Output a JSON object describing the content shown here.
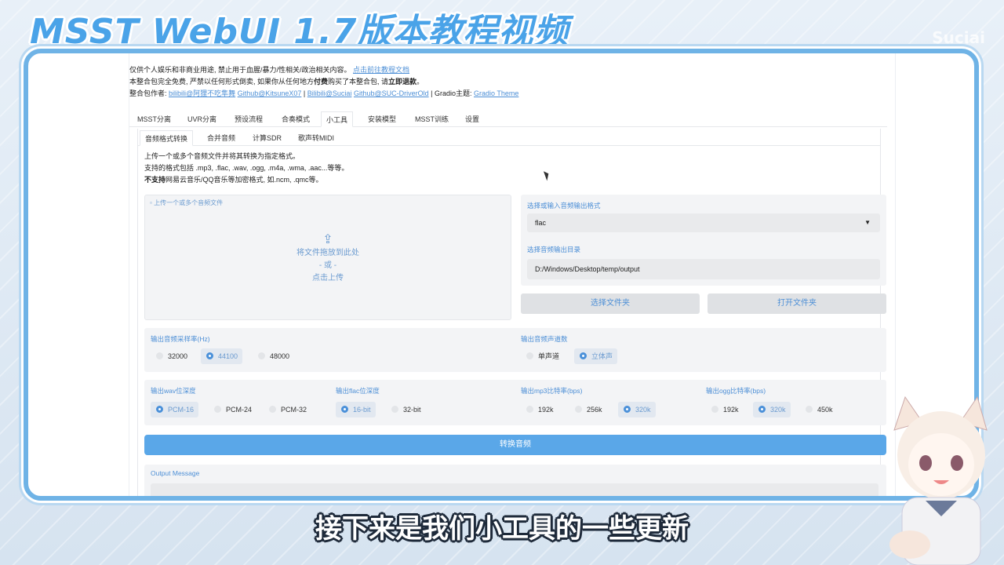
{
  "video": {
    "title": "MSST WebUI 1.7版本教程视频",
    "watermark": "Suciai",
    "subtitle": "接下来是我们小工具的一些更新"
  },
  "intro": {
    "line1_text": "仅供个人娱乐和非商业用途, 禁止用于血腥/暴力/性相关/政治相关内容。",
    "line1_link": "点击前往教程文档",
    "line2_pre": "本整合包完全免费, 严禁以任何形式倒卖, 如果你从任何地方",
    "line2_bold1": "付费",
    "line2_mid": "购买了本整合包, 请",
    "line2_bold2": "立即退款",
    "line2_end": "。",
    "line3_label": "整合包作者:",
    "author_links": [
      "bilibili@阿狸不吃隼舞",
      "Github@KitsuneX07",
      "Bilibili@Suciai",
      "Github@SUC-DriverOld"
    ],
    "sep": "|",
    "gradio_label": "| Gradio主题:",
    "gradio_link": "Gradio Theme"
  },
  "tabs": [
    "MSST分离",
    "UVR分离",
    "预设流程",
    "合奏模式",
    "小工具",
    "安装模型",
    "MSST训练",
    "设置"
  ],
  "subtabs": [
    "音频格式转换",
    "合并音频",
    "计算SDR",
    "歌声转MIDI"
  ],
  "desc": {
    "line1": "上传一个或多个音频文件并将其转换为指定格式。",
    "line2": "支持的格式包括 .mp3, .flac, .wav, .ogg, .m4a, .wma, .aac...等等。",
    "line3_bold": "不支持",
    "line3_rest": "网易云音乐/QQ音乐等加密格式, 如.ncm, .qmc等。"
  },
  "upload": {
    "label": "上传一个或多个音频文件",
    "drop_text": "将文件拖放到此处",
    "or_text": "- 或 -",
    "click_text": "点击上传"
  },
  "format": {
    "label": "选择或输入音频输出格式",
    "value": "flac",
    "dir_label": "选择音频输出目录",
    "dir_value": "D:/Windows/Desktop/temp/output"
  },
  "buttons": {
    "select_folder": "选择文件夹",
    "open_folder": "打开文件夹",
    "convert": "转换音频"
  },
  "sample_rate": {
    "label": "输出音频采样率(Hz)",
    "options": [
      "32000",
      "44100",
      "48000"
    ],
    "selected": "44100"
  },
  "channels": {
    "label": "输出音频声道数",
    "options": [
      "单声道",
      "立体声"
    ],
    "selected": "立体声"
  },
  "wav_depth": {
    "label": "输出wav位深度",
    "options": [
      "PCM-16",
      "PCM-24",
      "PCM-32"
    ],
    "selected": "PCM-16"
  },
  "flac_depth": {
    "label": "输出flac位深度",
    "options": [
      "16-bit",
      "32-bit"
    ],
    "selected": "16-bit"
  },
  "mp3_bitrate": {
    "label": "输出mp3比特率(bps)",
    "options": [
      "192k",
      "256k",
      "320k"
    ],
    "selected": "320k"
  },
  "ogg_bitrate": {
    "label": "输出ogg比特率(bps)",
    "options": [
      "192k",
      "320k",
      "450k"
    ],
    "selected": "320k"
  },
  "output": {
    "label": "Output Message"
  },
  "colors": {
    "accent": "#4a90d9",
    "primary_button": "#5aa7e8",
    "frame": "#6fb3e6"
  }
}
